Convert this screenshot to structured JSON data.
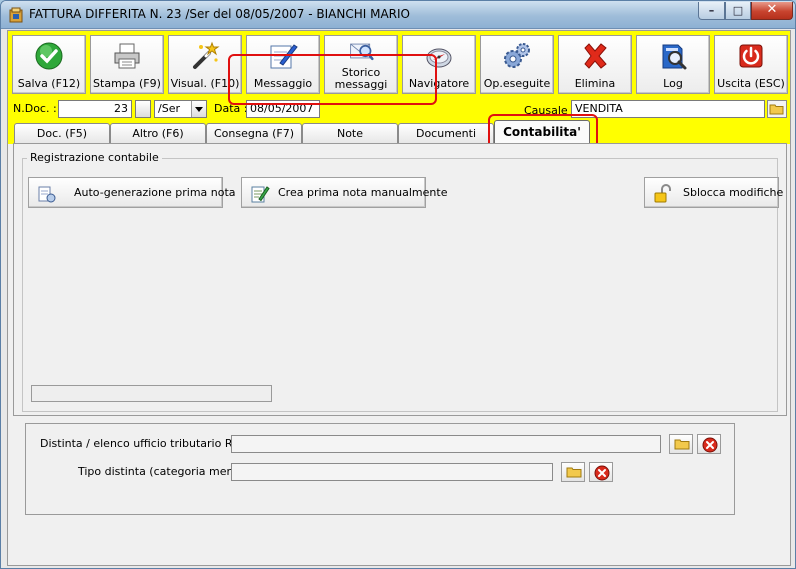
{
  "window": {
    "title": "FATTURA DIFFERITA N. 23 /Ser del 08/05/2007 - BIANCHI MARIO",
    "minimize_glyph": "–",
    "maximize_glyph": "□",
    "close_glyph": "✕"
  },
  "toolbar": {
    "buttons": [
      {
        "label": "Salva (F12)",
        "icon": "check-icon"
      },
      {
        "label": "Stampa (F9)",
        "icon": "printer-icon"
      },
      {
        "label": "Visual. (F10)",
        "icon": "magic-wand-icon"
      },
      {
        "label": "Messaggio",
        "icon": "pen-message-icon"
      },
      {
        "label_line1": "Storico",
        "label_line2": "messaggi",
        "icon": "message-history-icon"
      },
      {
        "label": "Navigatore",
        "icon": "compass-icon"
      },
      {
        "label": "Op.eseguite",
        "icon": "gears-icon"
      },
      {
        "label": "Elimina",
        "icon": "delete-x-icon"
      },
      {
        "label": "Log",
        "icon": "log-book-icon"
      },
      {
        "label": "Uscita (ESC)",
        "icon": "exit-power-icon"
      }
    ]
  },
  "docbar": {
    "ndoc_label": "N.Doc. :",
    "ndoc_value": "23",
    "series_value": "/Ser",
    "data_label": "Data :",
    "data_value": "08/05/2007",
    "causale_label": "Causale :",
    "causale_value": "VENDITA"
  },
  "tabs": [
    {
      "label": "Doc. (F5)"
    },
    {
      "label": "Altro (F6)"
    },
    {
      "label": "Consegna (F7)"
    },
    {
      "label": "Note"
    },
    {
      "label": "Documenti"
    },
    {
      "label": "Contabilita'"
    }
  ],
  "active_tab": "Contabilita'",
  "contabilita": {
    "group_title": "Registrazione contabile",
    "auto_button": "Auto-generazione prima nota",
    "manual_button": "Crea prima nota manualmente",
    "unlock_button": "Sblocca modifiche"
  },
  "lower": {
    "distinta_label": "Distinta / elenco ufficio tributario RSM :",
    "distinta_value": "",
    "tipo_label": "Tipo distinta (categoria merce) :",
    "tipo_value": ""
  },
  "colors": {
    "toolbar_bg": "#ffff00",
    "highlight": "#e01010"
  }
}
